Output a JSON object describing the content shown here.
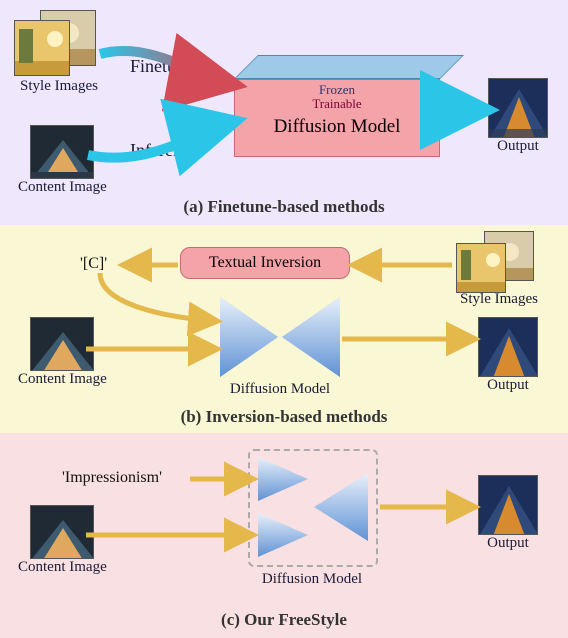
{
  "panelA": {
    "caption": "(a) Finetune-based methods",
    "styleImagesLabel": "Style Images",
    "contentImageLabel": "Content Image",
    "outputLabel": "Output",
    "finetuneLabel": "Finetune",
    "inferenceLabel": "Inference",
    "frozenLabel": "Frozen",
    "trainableLabel": "Trainable",
    "modelLabel": "Diffusion Model"
  },
  "panelB": {
    "caption": "(b) Inversion-based methods",
    "token": "'[C]'",
    "tiLabel": "Textual Inversion",
    "styleImagesLabel": "Style Images",
    "contentImageLabel": "Content Image",
    "modelLabel": "Diffusion Model",
    "outputLabel": "Output"
  },
  "panelC": {
    "caption": "(c) Our FreeStyle",
    "token": "'Impressionism'",
    "contentImageLabel": "Content Image",
    "modelLabel": "Diffusion Model",
    "outputLabel": "Output"
  }
}
